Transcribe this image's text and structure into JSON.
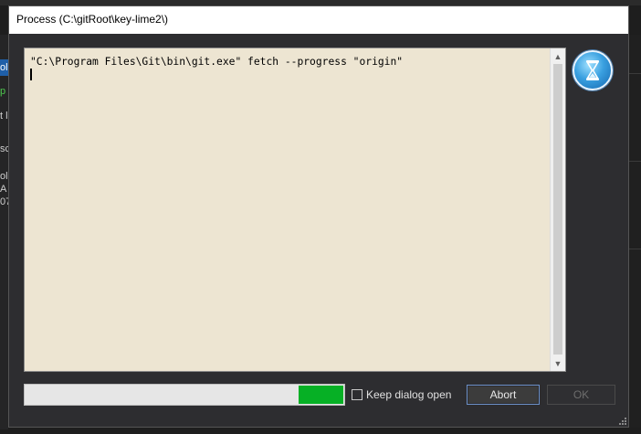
{
  "dialog": {
    "title": "Process (C:\\gitRoot\\key-lime2\\)"
  },
  "console": {
    "lines": [
      "\"C:\\Program Files\\Git\\bin\\git.exe\" fetch --progress \"origin\""
    ]
  },
  "progress": {
    "fraction": 0.14
  },
  "keep_dialog": {
    "label": "Keep dialog open",
    "checked": false
  },
  "buttons": {
    "abort": "Abort",
    "ok": "OK",
    "ok_enabled": false
  },
  "background": {
    "fragments": [
      "ol",
      "p",
      "t l",
      "sc",
      "ol",
      "A",
      "07"
    ]
  },
  "colors": {
    "progress_fill": "#06b025",
    "console_bg": "#ede5d2",
    "dialog_bg": "#2d2d30"
  },
  "icons": {
    "status": "hourglass-icon"
  }
}
